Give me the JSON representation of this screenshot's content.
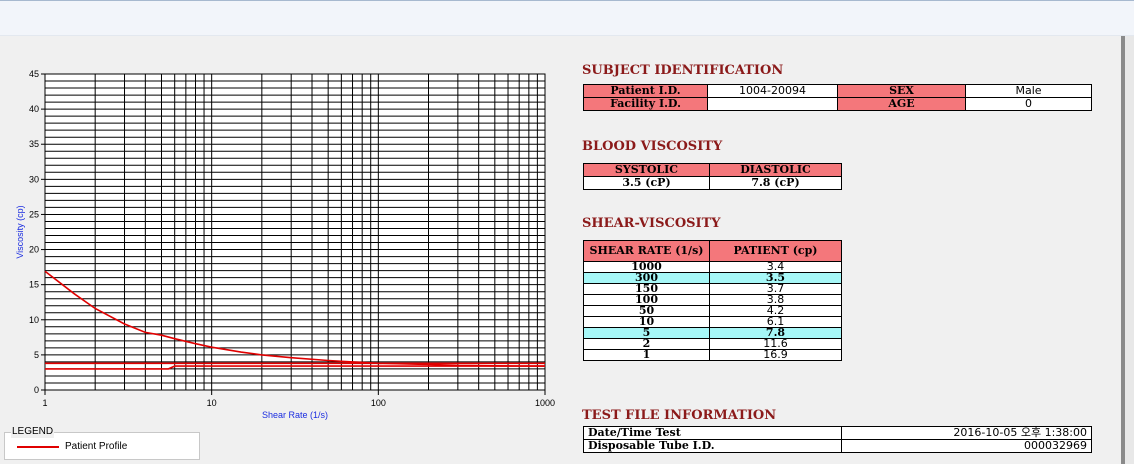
{
  "chart_data": {
    "type": "line",
    "xscale": "log",
    "xlim": [
      1,
      1000
    ],
    "ylim": [
      0,
      45
    ],
    "xlabel": "Shear Rate (1/s)",
    "ylabel": "Viscosity (cp)",
    "grid": true,
    "x_ticks": [
      "1",
      "10",
      "100",
      "1000"
    ],
    "y_ticks": [
      "0",
      "5",
      "10",
      "15",
      "20",
      "25",
      "30",
      "35",
      "40",
      "45"
    ],
    "series": [
      {
        "name": "Patient Profile",
        "color": "#e00000",
        "x": [
          1,
          1.5,
          2,
          3,
          4,
          5,
          6,
          8,
          10,
          15,
          20,
          30,
          50,
          70,
          100,
          150,
          200,
          300,
          500,
          700,
          1000
        ],
        "y": [
          16.9,
          13.7,
          11.6,
          9.4,
          8.2,
          7.8,
          7.3,
          6.6,
          6.1,
          5.4,
          5.0,
          4.6,
          4.2,
          4.0,
          3.8,
          3.7,
          3.65,
          3.5,
          3.45,
          3.42,
          3.4
        ]
      },
      {
        "color": "#e00000",
        "x": [
          1,
          5.5,
          6,
          1000
        ],
        "y": [
          3.0,
          3.0,
          3.4,
          3.4
        ]
      },
      {
        "color": "#e00000",
        "x": [
          1,
          1000
        ],
        "y": [
          3.8,
          3.8
        ]
      }
    ]
  },
  "legend": {
    "title": "LEGEND",
    "label": "Patient Profile"
  },
  "subject": {
    "title": "SUBJECT IDENTIFICATION",
    "patient_id_label": "Patient I.D.",
    "patient_id": "1004-20094",
    "sex_label": "SEX",
    "sex": "Male",
    "facility_label": "Facility I.D.",
    "facility": "",
    "age_label": "AGE",
    "age": "0"
  },
  "blood": {
    "title": "BLOOD VISCOSITY",
    "systolic_label": "SYSTOLIC",
    "diastolic_label": "DIASTOLIC",
    "systolic": "3.5 (cP)",
    "diastolic": "7.8 (cP)"
  },
  "shear": {
    "title": "SHEAR-VISCOSITY",
    "col_rate": "SHEAR RATE (1/s)",
    "col_patient": "PATIENT (cp)",
    "rows": [
      {
        "rate": "1000",
        "value": "3.4",
        "hl": false
      },
      {
        "rate": "300",
        "value": "3.5",
        "hl": true
      },
      {
        "rate": "150",
        "value": "3.7",
        "hl": false
      },
      {
        "rate": "100",
        "value": "3.8",
        "hl": false
      },
      {
        "rate": "50",
        "value": "4.2",
        "hl": false
      },
      {
        "rate": "10",
        "value": "6.1",
        "hl": false
      },
      {
        "rate": "5",
        "value": "7.8",
        "hl": true
      },
      {
        "rate": "2",
        "value": "11.6",
        "hl": false
      },
      {
        "rate": "1",
        "value": "16.9",
        "hl": false
      }
    ]
  },
  "testfile": {
    "title": "TEST FILE INFORMATION",
    "datetime_label": "Date/Time Test",
    "datetime": "2016-10-05  오후 1:38:00",
    "tube_label": "Disposable Tube I.D.",
    "tube": "000032969"
  }
}
